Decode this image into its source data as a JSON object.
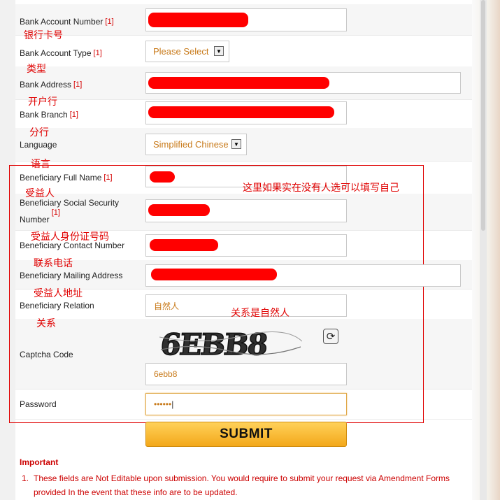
{
  "form": {
    "bank_account_number": {
      "label": "Bank Account Number",
      "ref": "[1]",
      "annotation": "银行卡号"
    },
    "bank_account_type": {
      "label": "Bank Account Type",
      "ref": "[1]",
      "annotation": "类型",
      "value": "Please Select"
    },
    "bank_address": {
      "label": "Bank Address",
      "ref": "[1]",
      "annotation": "开户行"
    },
    "bank_branch": {
      "label": "Bank Branch",
      "ref": "[1]",
      "annotation": "分行"
    },
    "language": {
      "label": "Language",
      "annotation": "语言",
      "value": "Simplified Chinese"
    },
    "beneficiary_full_name": {
      "label": "Beneficiary Full Name",
      "ref": "[1]",
      "annotation": "受益人"
    },
    "beneficiary_ssn": {
      "label_line1": "Beneficiary Social Security",
      "label_line2": "Number",
      "ref": "[1]",
      "annotation": "受益人身份证号码"
    },
    "beneficiary_contact": {
      "label": "Beneficiary Contact Number",
      "annotation": "联系电话"
    },
    "beneficiary_mailing": {
      "label": "Beneficiary Mailing Address",
      "annotation": "受益人地址"
    },
    "beneficiary_relation": {
      "label": "Beneficiary Relation",
      "annotation": "关系",
      "value": "自然人",
      "side_note": "关系是自然人"
    },
    "captcha": {
      "label": "Captcha Code",
      "image_text": "6EBB8",
      "value": "6ebb8"
    },
    "password": {
      "label": "Password",
      "value": "••••••"
    },
    "submit_label": "SUBMIT"
  },
  "annotations": {
    "beneficiary_note": "这里如果实在没有人选可以填写自己"
  },
  "notes": {
    "title": "Important",
    "items": [
      {
        "num": "1.",
        "text": "These fields are Not Editable upon submission. You would require to submit your request via Amendment Forms provided In the event that these info are to be updated."
      }
    ]
  },
  "icons": {
    "refresh": "refresh-icon",
    "dropdown": "chevron-down-icon"
  },
  "colors": {
    "annotation_red": "#e00000",
    "value_orange": "#c87a1a",
    "submit_gradient_top": "#ffd15a",
    "submit_gradient_bottom": "#f3a81a"
  }
}
